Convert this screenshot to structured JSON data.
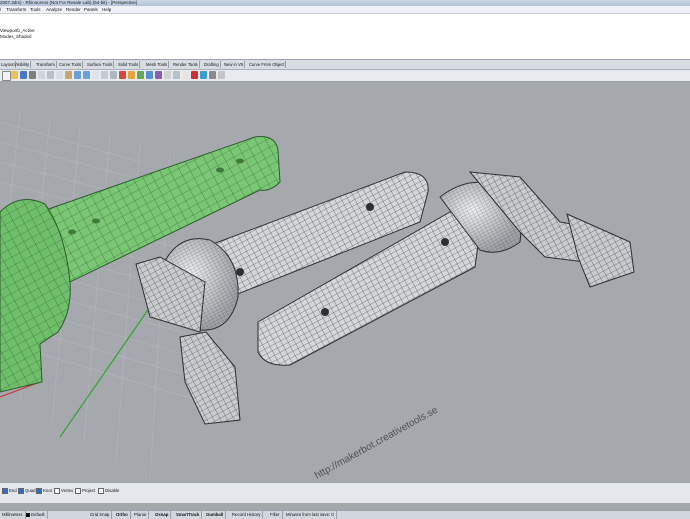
{
  "window": {
    "title": "2007.3dm) - Rhinoceros (Not For Resale Lab) (64-bit) - [Perspective]"
  },
  "menu": [
    "/",
    "Transform",
    "Tools",
    "Analyze",
    "Render",
    "Panels",
    "Help"
  ],
  "command_history": [
    "Viewportb_Active",
    "Modes_Shaded"
  ],
  "toolbar_tabs": [
    "Layout",
    "Visibility",
    "Transform",
    "Curve Tools",
    "Surface Tools",
    "Solid Tools",
    "Mesh Tools",
    "Render Tools",
    "Drafting",
    "New in V5",
    "Curve From Object"
  ],
  "viewport": {
    "name": "Perspective",
    "watermark": "http://makerbot.creativetools.se",
    "colors": {
      "background": "#a5a9ae",
      "selected": "#6fbf6a",
      "mesh": "#2e2f31"
    }
  },
  "osnaps": [
    {
      "label": "End",
      "checked": true
    },
    {
      "label": "Quad",
      "checked": true
    },
    {
      "label": "Knot",
      "checked": true
    },
    {
      "label": "Vertex",
      "checked": false
    },
    {
      "label": "Project",
      "checked": false
    },
    {
      "label": "Disable",
      "checked": false
    }
  ],
  "status": {
    "units": "Millimeters",
    "layer": "Default",
    "items": [
      "Grid Snap",
      "Ortho",
      "Planar",
      "Osnap",
      "SmartTrack",
      "Gumball",
      "Record History",
      "Filter",
      "Minutes from last save: 0"
    ]
  }
}
